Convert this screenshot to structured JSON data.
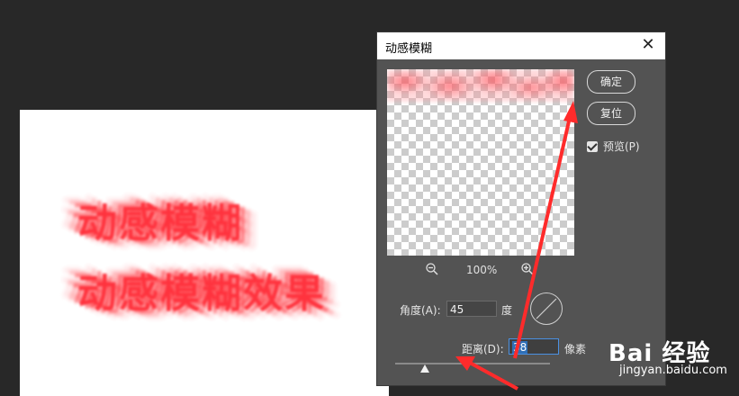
{
  "canvas": {
    "text_line1": "动感模糊",
    "text_line2": "动感模糊效果"
  },
  "dialog": {
    "title": "动感模糊",
    "close_glyph": "✕",
    "ok_label": "确定",
    "reset_label": "复位",
    "preview_label": "预览(P)",
    "preview_checked": true,
    "zoom_level": "100%",
    "angle_label": "角度(A):",
    "angle_value": "45",
    "angle_unit": "度",
    "distance_label": "距离(D):",
    "distance_value": "38",
    "distance_unit": "像素",
    "distance_slider_fraction": 0.19
  },
  "watermark": {
    "logo_text": "Bai 经验",
    "url": "jingyan.baidu.com"
  },
  "colors": {
    "accent_arrow": "#ff2b2b",
    "focus_border": "#4a90e2",
    "dialog_bg": "#535353",
    "workspace_bg": "#282828"
  }
}
